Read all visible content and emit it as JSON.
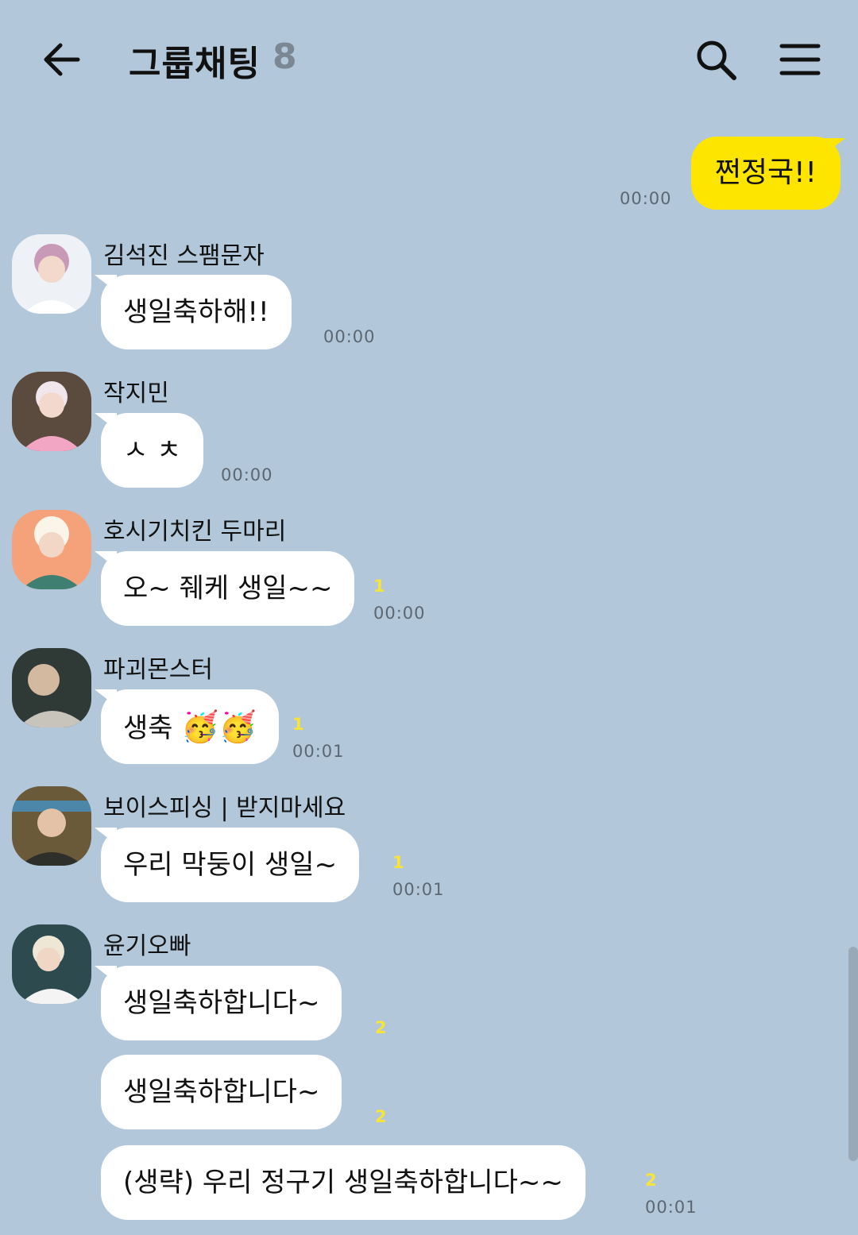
{
  "header": {
    "title": "그룹채팅",
    "member_count": "8",
    "icons": {
      "back": "back-arrow-icon",
      "search": "search-icon",
      "menu": "menu-icon"
    }
  },
  "colors": {
    "background": "#b2c7da",
    "my_bubble": "#fee500",
    "other_bubble": "#ffffff",
    "unread": "#f6e43a",
    "time": "#5c6772"
  },
  "my_message": {
    "text": "쩐정국!!",
    "time": "00:00"
  },
  "messages": [
    {
      "sender": "김석진 스팸문자",
      "text": "생일축하해!!",
      "unread": "",
      "time": "00:00"
    },
    {
      "sender": "작지민",
      "text": "ㅅ ㅊ",
      "unread": "",
      "time": "00:00"
    },
    {
      "sender": "호시기치킨 두마리",
      "text": "오~ 줴케 생일~~",
      "unread": "1",
      "time": "00:00"
    },
    {
      "sender": "파괴몬스터",
      "text": "생축",
      "emoji": "🥳🥳",
      "unread": "1",
      "time": "00:01"
    },
    {
      "sender": "보이스피싱 | 받지마세요",
      "text": "우리 막둥이 생일~",
      "unread": "1",
      "time": "00:01"
    },
    {
      "sender": "윤기오빠",
      "text": "생일축하합니다~",
      "unread": "2",
      "time": ""
    },
    {
      "text": "생일축하합니다~",
      "unread": "2",
      "time": ""
    },
    {
      "text": "(생략) 우리 정구기 생일축하합니다~~",
      "unread": "2",
      "time": "00:01"
    }
  ]
}
